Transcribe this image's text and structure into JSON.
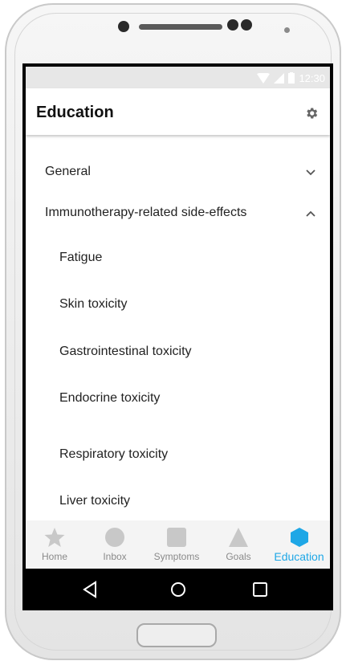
{
  "status": {
    "time": "12:30"
  },
  "appbar": {
    "title": "Education",
    "settings_icon": "gear-icon"
  },
  "sections": [
    {
      "label": "General",
      "expanded": false
    },
    {
      "label": "Immunotherapy-related side-effects",
      "expanded": true
    }
  ],
  "subitems": [
    "Fatigue",
    "Skin toxicity",
    "Gastrointestinal toxicity",
    "Endocrine toxicity",
    "Respiratory toxicity",
    "Liver toxicity"
  ],
  "tabs": [
    {
      "label": "Home",
      "icon": "star-icon"
    },
    {
      "label": "Inbox",
      "icon": "circle-icon"
    },
    {
      "label": "Symptoms",
      "icon": "square-icon"
    },
    {
      "label": "Goals",
      "icon": "triangle-icon"
    },
    {
      "label": "Education",
      "icon": "hexagon-icon",
      "active": true
    }
  ],
  "colors": {
    "accent": "#1ea7e6",
    "tab_icon_inactive": "#c8c8c8",
    "tab_label_inactive": "#8a8a8a"
  },
  "navbar": {
    "back_icon": "back-triangle-icon",
    "home_icon": "home-circle-icon",
    "recents_icon": "recents-square-icon"
  }
}
